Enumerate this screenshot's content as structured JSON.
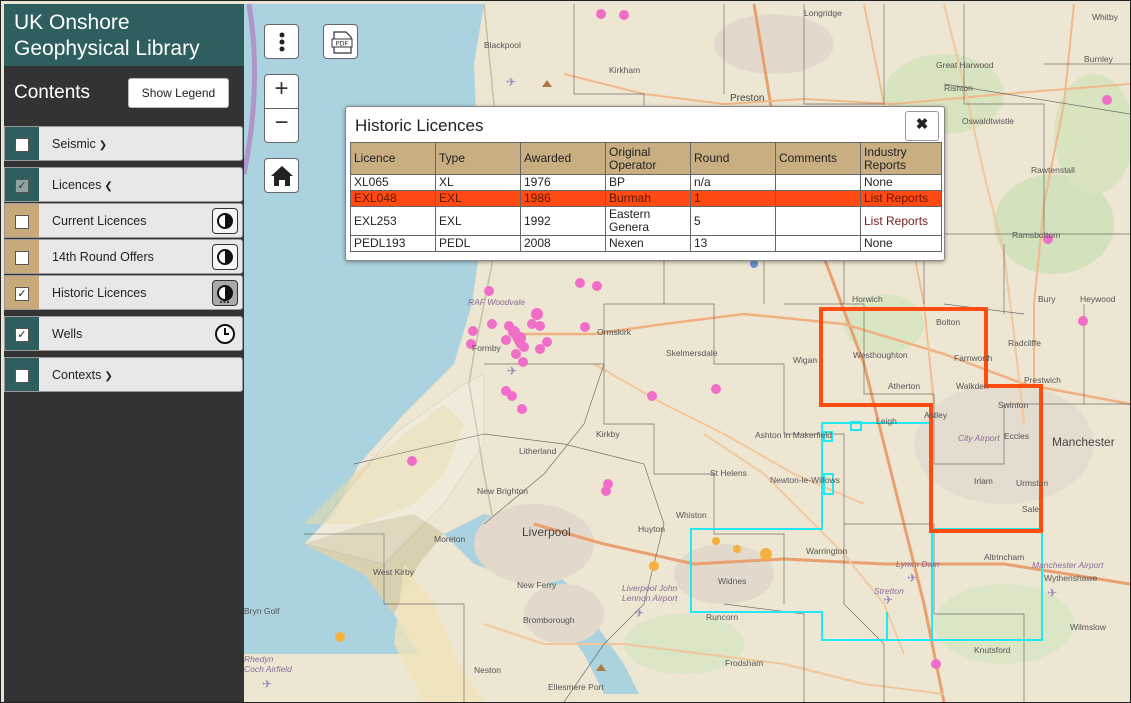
{
  "app": {
    "title_line1": "UK Onshore",
    "title_line2": "Geophysical Library"
  },
  "sidebar": {
    "contents_title": "Contents",
    "show_legend_label": "Show Legend",
    "layers": [
      {
        "label": "Seismic",
        "checked": false,
        "expandable": true,
        "expanded": false
      },
      {
        "label": "Licences",
        "checked": true,
        "expandable": true,
        "expanded": true
      },
      {
        "label": "Current Licences",
        "checked": false,
        "control": "opacity-icon"
      },
      {
        "label": "14th Round Offers",
        "checked": false,
        "control": "opacity-icon"
      },
      {
        "label": "Historic Licences",
        "checked": true,
        "control": "opacity-icon"
      },
      {
        "label": "Wells",
        "checked": true,
        "control": "clock-icon"
      },
      {
        "label": "Contexts",
        "checked": false,
        "expandable": true,
        "expanded": false
      }
    ],
    "check_glyph": "✓"
  },
  "map_controls": {
    "zoom_in": "+",
    "zoom_out": "−",
    "pdf": "PDF"
  },
  "popup": {
    "title": "Historic Licences",
    "close_glyph": "✖",
    "columns": [
      "Licence",
      "Type",
      "Awarded",
      "Original Operator",
      "Round",
      "Comments",
      "Industry Reports"
    ],
    "rows": [
      [
        "XL065",
        "XL",
        "1976",
        "BP",
        "n/a",
        "",
        "None"
      ],
      [
        "EXL048",
        "EXL",
        "1986",
        "Burmah",
        "1",
        "",
        "List Reports"
      ],
      [
        "EXL253",
        "EXL",
        "1992",
        "Eastern Genera",
        "5",
        "",
        "List Reports"
      ],
      [
        "PEDL193",
        "PEDL",
        "2008",
        "Nexen",
        "13",
        "",
        "None"
      ]
    ],
    "selected_row": 1
  },
  "map_labels": [
    "Longridge",
    "Whitby",
    "Blackpool",
    "Kirkham",
    "Preston",
    "Great Harwood",
    "Burnley",
    "Oswaldtwistle",
    "Rishton",
    "Rawtenstall",
    "Ramsbottom",
    "Horwich",
    "Bolton",
    "Bury",
    "Heywood",
    "Radcliffe",
    "Prestwich",
    "Westhoughton",
    "Farnworth",
    "Walkden",
    "Atherton",
    "Swinton",
    "Wigan",
    "Skelmersdale",
    "Ormskirk",
    "Formby",
    "Leigh",
    "Astley",
    "Eccles",
    "Manchester",
    "City Airport",
    "Ashton in Makerfield",
    "Kirkby",
    "St Helens",
    "Newton-le-Willows",
    "Irlam",
    "Urmston",
    "Sale",
    "Litherland",
    "New Brighton",
    "Liverpool",
    "Huyton",
    "Whiston",
    "Warrington",
    "Altrincham",
    "Wythenshawe",
    "West Kirby",
    "Moreton",
    "New Ferry",
    "Widnes",
    "Bromborough",
    "Runcorn",
    "Lymm Dam",
    "Stretton",
    "Manchester Airport",
    "Wilmslow",
    "Knutsford",
    "Frodsham",
    "Neston",
    "Ellesmere Port",
    "RAF Woodvale",
    "Liverpool John Lennon Airport",
    "Rhedyn Coch Airfield",
    "Bryn Golf",
    "Prestatyn"
  ],
  "colors": {
    "sidebar_header": "#2e5e5e",
    "legend_tan": "#c9a97b",
    "selected_row": "#ff4a13",
    "licence_outline": "#ff4d12",
    "licence_outline_cyan": "#22e8f0",
    "well_dot": "#f06ec8",
    "sea": "#aad3df"
  }
}
